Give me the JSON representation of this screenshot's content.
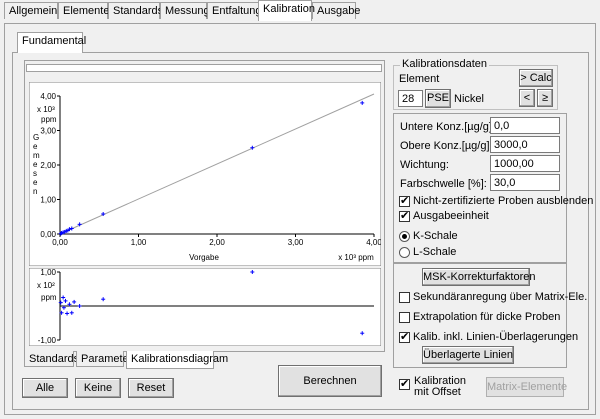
{
  "top_tabs": [
    "Allgemein",
    "Elemente",
    "Standards",
    "Messung",
    "Entfaltung",
    "Kalibration",
    "Ausgabe"
  ],
  "sub_tab": "Fundamental",
  "bottom_tabs": [
    "Standards",
    "Parameter",
    "Kalibrationsdiagram"
  ],
  "buttons": {
    "alle": "Alle",
    "keine": "Keine",
    "reset": "Reset",
    "berechnen": "Berechnen",
    "calc": "> Calc",
    "prev": "<",
    "next": "≥",
    "pse": "PSE",
    "msk": "MSK-Korrekturfaktoren",
    "ueberlagerte": "Überlagerte Linien",
    "matrix": "Matrix-Elemente"
  },
  "kalib": {
    "group_title": "Kalibrationsdaten",
    "element_label": "Element",
    "element_number": "28",
    "element_name": "Nickel",
    "untere_label": "Untere Konz.[µg/g]:",
    "untere_value": "0,0",
    "obere_label": "Obere Konz.[µg/g]:",
    "obere_value": "3000,0",
    "wichtung_label": "Wichtung:",
    "wichtung_value": "1000,00",
    "farb_label": "Farbschwelle [%]:",
    "farb_value": "30,0",
    "nicht_zert": "Nicht-zertifizierte Proben ausblenden",
    "ausgabe": "Ausgabeeinheit",
    "k_schale": "K-Schale",
    "l_schale": "L-Schale",
    "sekundaer": "Sekundäranregung über Matrix-Ele.",
    "extrapolation": "Extrapolation für dicke Proben",
    "kalib_inkl": "Kalib. inkl. Linien-Überlagerungen",
    "offset_line1": "Kalibration",
    "offset_line2": "mit Offset"
  },
  "chart_data": [
    {
      "type": "scatter",
      "xlabel": "Vorgabe",
      "ylabel": "Gemesen",
      "x_unit": "x 10³ ppm",
      "y_unit_top": "x 10³",
      "y_unit_bottom": "ppm",
      "xlim": [
        0,
        4
      ],
      "ylim": [
        0,
        4
      ],
      "x_ticks": [
        "0,00",
        "1,00",
        "2,00",
        "3,00",
        "4,00"
      ],
      "y_ticks": [
        "0,00",
        "1,00",
        "2,00",
        "3,00",
        "4,00"
      ],
      "points": [
        [
          0.01,
          0.01
        ],
        [
          0.02,
          0.03
        ],
        [
          0.04,
          0.05
        ],
        [
          0.06,
          0.06
        ],
        [
          0.08,
          0.09
        ],
        [
          0.1,
          0.1
        ],
        [
          0.12,
          0.14
        ],
        [
          0.15,
          0.16
        ],
        [
          0.25,
          0.28
        ],
        [
          0.55,
          0.58
        ],
        [
          2.45,
          2.5
        ],
        [
          3.85,
          3.8
        ]
      ]
    },
    {
      "type": "scatter",
      "ylabel_top": "x 10²",
      "ylabel_bottom": "ppm",
      "xlim": [
        0,
        4
      ],
      "ylim": [
        -1,
        1
      ],
      "y_ticks": [
        "1,00",
        "-1,00"
      ],
      "points": [
        [
          0.01,
          0.1
        ],
        [
          0.02,
          -0.2
        ],
        [
          0.04,
          0.25
        ],
        [
          0.05,
          -0.05
        ],
        [
          0.07,
          0.15
        ],
        [
          0.09,
          -0.22
        ],
        [
          0.12,
          0.05
        ],
        [
          0.15,
          -0.2
        ],
        [
          0.18,
          0.12
        ],
        [
          0.25,
          0.0
        ],
        [
          0.55,
          0.2
        ],
        [
          2.45,
          1.0
        ],
        [
          3.85,
          -0.8
        ]
      ]
    }
  ]
}
